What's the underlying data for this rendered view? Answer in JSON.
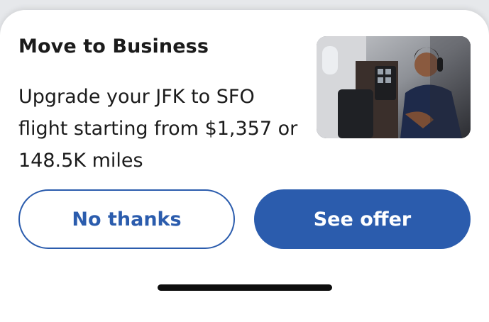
{
  "offer": {
    "title": "Move to Business",
    "body_line1": "Upgrade your JFK to SFO",
    "body_line2": "flight starting from $1,357 or",
    "body_line3": "148.5K miles",
    "image": "business-class-passenger-photo"
  },
  "buttons": {
    "decline_label": "No thanks",
    "accept_label": "See offer"
  },
  "colors": {
    "brand_blue": "#2b5cad",
    "text": "#1b1b1b",
    "sheet_bg": "#ffffff"
  }
}
